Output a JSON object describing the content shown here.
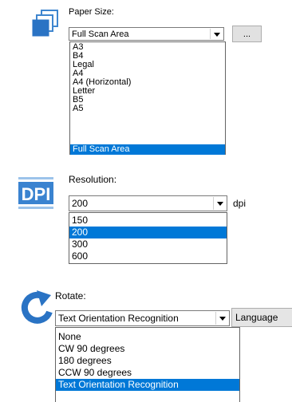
{
  "paper_size": {
    "label": "Paper Size:",
    "value": "Full Scan Area",
    "browse_label": "...",
    "options": [
      "A3",
      "B4",
      "Legal",
      "A4",
      "A4 (Horizontal)",
      "Letter",
      "B5",
      "A5",
      "Full Scan Area"
    ],
    "selected_index": 8,
    "icon": "paper-stack-icon"
  },
  "resolution": {
    "label": "Resolution:",
    "value": "200",
    "unit": "dpi",
    "options": [
      "150",
      "200",
      "300",
      "600"
    ],
    "selected_index": 1,
    "icon": "dpi-icon",
    "icon_text": "DPI"
  },
  "rotate": {
    "label": "Rotate:",
    "value": "Text Orientation Recognition",
    "language_button": "Language",
    "options": [
      "None",
      "CW 90 degrees",
      "180 degrees",
      "CCW 90 degrees",
      "Text Orientation Recognition"
    ],
    "selected_index": 4,
    "icon": "rotate-icon"
  },
  "colors": {
    "selection": "#0078d7",
    "icon_blue": "#1f6fbf"
  }
}
